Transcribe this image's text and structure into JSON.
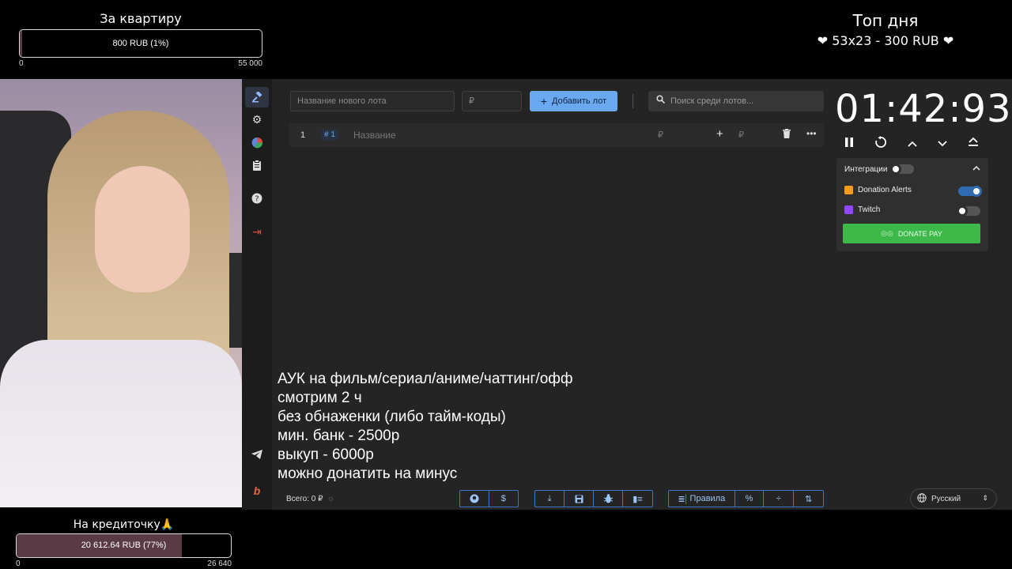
{
  "goal_top": {
    "title": "За квартиру",
    "bar_text": "800 RUB (1%)",
    "progress": 0.01,
    "min": "0",
    "max": "55 000"
  },
  "top_day": {
    "title": "Топ дня",
    "line": "❤ 53x23 - 300 RUB ❤"
  },
  "sidebar": {
    "items": [
      {
        "icon": "gavel-icon",
        "glyph": "⚒"
      },
      {
        "icon": "gear-icon",
        "glyph": "⚙"
      },
      {
        "icon": "pie-chart-icon",
        "glyph": "◕"
      },
      {
        "icon": "clipboard-icon",
        "glyph": "▤"
      },
      {
        "icon": "help-icon",
        "glyph": "?"
      },
      {
        "icon": "logout-icon",
        "glyph": "⇥"
      },
      {
        "icon": "telegram-icon",
        "glyph": "➤"
      },
      {
        "icon": "boosty-icon",
        "glyph": "b"
      }
    ]
  },
  "toolbar": {
    "new_lot_placeholder": "Название нового лота",
    "amount_placeholder": "₽",
    "add_lot_label": "Добавить лот",
    "search_placeholder": "Поиск среди лотов..."
  },
  "lot": {
    "number": "1",
    "id": "# 1",
    "name_placeholder": "Название",
    "currency": "₽"
  },
  "timer": {
    "value": "01:42:93"
  },
  "integrations": {
    "title": "Интеграции",
    "services": [
      {
        "name": "Donation Alerts",
        "on": true,
        "color": "#f59c1a"
      },
      {
        "name": "Twitch",
        "on": false,
        "color": "#9146ff"
      }
    ],
    "donate_label": "DONATE PAY"
  },
  "overlay_text": [
    "АУК на фильм/сериал/аниме/чаттинг/офф",
    "смотрим 2 ч",
    "без обнаженки (либо тайм-коды)",
    "мин. банк - 2500р",
    "выкуп - 6000р",
    "можно донатить на минус"
  ],
  "footer": {
    "total": "Всего: 0 ₽",
    "rules_label": "Правила",
    "language": "Русский"
  },
  "goal_bottom": {
    "title": "На кредиточку🙏",
    "bar_text": "20 612.64 RUB (77%)",
    "progress": 0.77,
    "min": "0",
    "max": "26 640"
  },
  "colors": {
    "accent": "#6aa8ef",
    "donate_green": "#3db94a",
    "goal_fill": "#5a3a44"
  }
}
